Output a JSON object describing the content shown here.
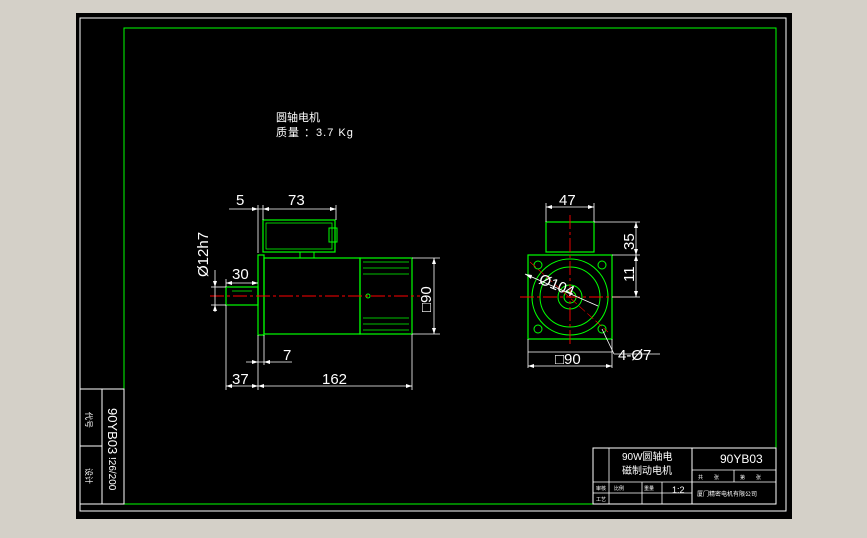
{
  "drawing": {
    "title_lines": [
      "圆轴电机",
      "质量 ：3.7 Kg"
    ],
    "dims": {
      "side": {
        "d5": "5",
        "d73": "73",
        "shaft_dia": "Ø12h7",
        "d30": "30",
        "d90": "□90",
        "d7": "7",
        "d37": "37",
        "d162": "162"
      },
      "front": {
        "d47": "47",
        "d35": "35",
        "d11": "11",
        "pcd": "Ø104",
        "holes": "4-Ø7",
        "d90": "□90"
      }
    },
    "side_strip": {
      "model": "90YB03",
      "date": "!26/200",
      "label_a": "代号",
      "label_b": "设计"
    },
    "title_block": {
      "name_line1": "90W圆轴电",
      "name_line2": "磁制动电机",
      "code": "90YB03",
      "scale": "1:2",
      "company": "厦门精密电机有限公司",
      "small": [
        "共",
        "张",
        "第",
        "张",
        "比例",
        "重量",
        "审核",
        "工艺"
      ]
    },
    "colors": {
      "background": "#000000",
      "frame": "#00ff00",
      "outline": "#00ff00",
      "center_line": "#ff0000",
      "dimension": "#ffffff",
      "window": "#d4d0c8"
    }
  }
}
